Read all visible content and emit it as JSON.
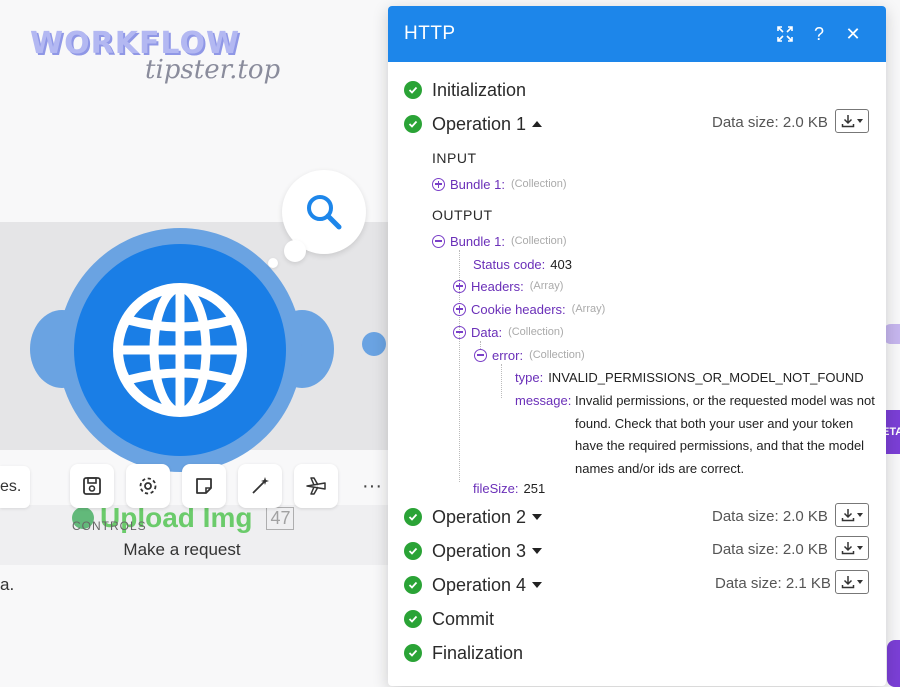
{
  "watermark": {
    "line1": "WORKFLOW",
    "line2": "tipster.top"
  },
  "canvas": {
    "partial_left_text": "es.",
    "partial_bottom_text": "a.",
    "controls_label": "CONTROLS",
    "upload_label": "Upload Img",
    "upload_count": "47",
    "node_name": "Make a request",
    "right_tab_text": "ETA"
  },
  "toolbar": {
    "buttons": [
      {
        "icon": "save-icon"
      },
      {
        "icon": "gear-icon"
      },
      {
        "icon": "note-icon"
      },
      {
        "icon": "magic-wand-icon"
      },
      {
        "icon": "airplane-icon"
      },
      {
        "icon": "more-icon"
      }
    ],
    "more_label": "···"
  },
  "panel": {
    "title": "HTTP",
    "header_buttons": [
      "expand-icon",
      "help-icon",
      "close-icon"
    ],
    "help_label": "?",
    "close_label": "✕",
    "steps": {
      "initialization": "Initialization",
      "op1": "Operation 1",
      "op2": "Operation 2",
      "op3": "Operation 3",
      "op4": "Operation 4",
      "commit": "Commit",
      "finalization": "Finalization"
    },
    "data_sizes": {
      "op1": "Data size: 2.0 KB",
      "op2": "Data size: 2.0 KB",
      "op3": "Data size: 2.0 KB",
      "op4": "Data size: 2.1 KB"
    },
    "input_label": "INPUT",
    "output_label": "OUTPUT",
    "tree": {
      "input_bundle": "Bundle 1:",
      "output_bundle": "Bundle 1:",
      "collection": "(Collection)",
      "array": "(Array)",
      "status_code_key": "Status code:",
      "status_code_val": "403",
      "headers_key": "Headers:",
      "cookie_headers_key": "Cookie headers:",
      "data_key": "Data:",
      "error_key": "error:",
      "type_key": "type:",
      "type_val": "INVALID_PERMISSIONS_OR_MODEL_NOT_FOUND",
      "message_key": "message:",
      "message_val": "Invalid permissions, or the requested model was not found. Check that both your user and your token have the required permissions, and that the model names and/or ids are correct.",
      "filesize_key": "fileSize:",
      "filesize_val": "251"
    }
  },
  "colors": {
    "header_blue": "#1d86ea",
    "node_blue": "#1a7ee6",
    "check_green": "#2aa336",
    "tree_purple": "#6a2fb8"
  }
}
